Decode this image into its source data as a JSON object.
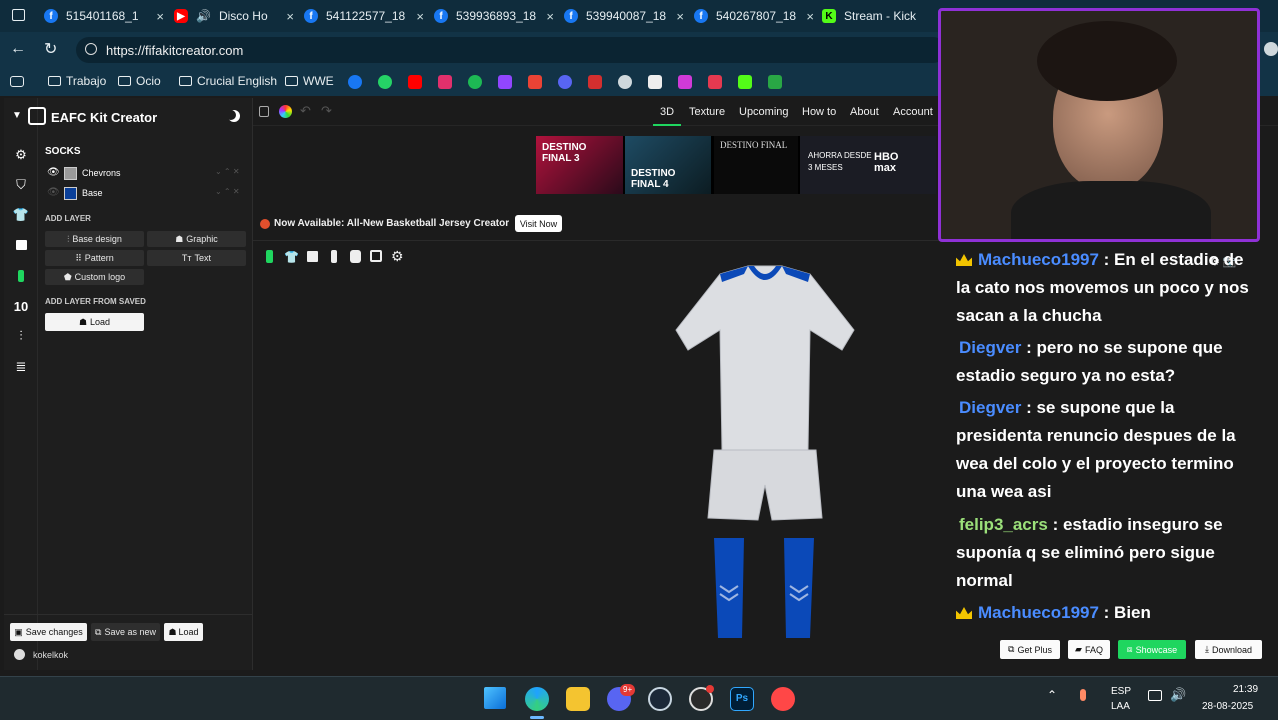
{
  "browser": {
    "tabs": [
      {
        "title": "515401168_1",
        "icon": "facebook-icon"
      },
      {
        "title": "Disco Ho",
        "icon": "youtube-icon"
      },
      {
        "title": "541122577_18",
        "icon": "facebook-icon"
      },
      {
        "title": "539936893_18",
        "icon": "facebook-icon"
      },
      {
        "title": "539940087_18",
        "icon": "facebook-icon"
      },
      {
        "title": "540267807_18",
        "icon": "facebook-icon"
      },
      {
        "title": "Stream - Kick",
        "icon": "kick-icon"
      }
    ],
    "url": "https://fifakitcreator.com",
    "bookmarks": [
      "Trabajo",
      "Ocio",
      "Crucial English",
      "WWE"
    ]
  },
  "app": {
    "title": "EAFC Kit Creator",
    "section": "SOCKS",
    "layers": [
      {
        "name": "Chevrons",
        "color": "#9a9a9a"
      },
      {
        "name": "Base",
        "color": "#0a3f99"
      }
    ],
    "add_layer_label": "ADD LAYER",
    "add_buttons": [
      "Base design",
      "Graphic",
      "Pattern",
      "Text",
      "Custom logo"
    ],
    "add_from_saved_label": "ADD LAYER FROM SAVED",
    "load_label": "Load",
    "save_changes": "Save changes",
    "save_as_new": "Save as new",
    "load_small": "Load",
    "user": "kokelkok",
    "sidebar_number": "10",
    "nav": [
      "3D",
      "Texture",
      "Upcoming",
      "How to",
      "About",
      "Account"
    ],
    "announcement": "Now Available: All-New Basketball Jersey Creator",
    "visit_now": "Visit Now",
    "ad_texts": [
      "DESTINO FINAL 3",
      "DESTINO FINAL 4",
      "DESTINO FINAL",
      "AHORRA DESDE 3 MESES",
      "HBO max"
    ],
    "bottom_buttons": [
      "Get Plus",
      "FAQ",
      "Showcase",
      "Download"
    ]
  },
  "chat": [
    {
      "user": "Machueco1997",
      "user_color": "#4a8cff",
      "crown": true,
      "text": " : En el estadio de la cato nos movemos un poco y nos sacan a la chucha"
    },
    {
      "user": "Diegver",
      "user_color": "#4a8cff",
      "crown": false,
      "text": " : pero no se supone que estadio seguro ya no esta?"
    },
    {
      "user": "Diegver",
      "user_color": "#4a8cff",
      "crown": false,
      "text": " : se supone que la presidenta renuncio despues de la wea del colo y el proyecto termino una wea asi"
    },
    {
      "user": "felip3_acrs",
      "user_color": "#9be07a",
      "crown": false,
      "text": " : estadio inseguro se suponía q se eliminó pero sigue normal"
    },
    {
      "user": "Machueco1997",
      "user_color": "#4a8cff",
      "crown": true,
      "text": " : Bien"
    }
  ],
  "taskbar": {
    "lang": "ESP",
    "lang2": "LAA",
    "time": "21:39",
    "date": "28-08-2025",
    "badge": "9+"
  },
  "colors": {
    "accent_purple": "#8f31d6",
    "showcase_green": "#1fd65f",
    "kit_blue": "#0b49b8"
  }
}
